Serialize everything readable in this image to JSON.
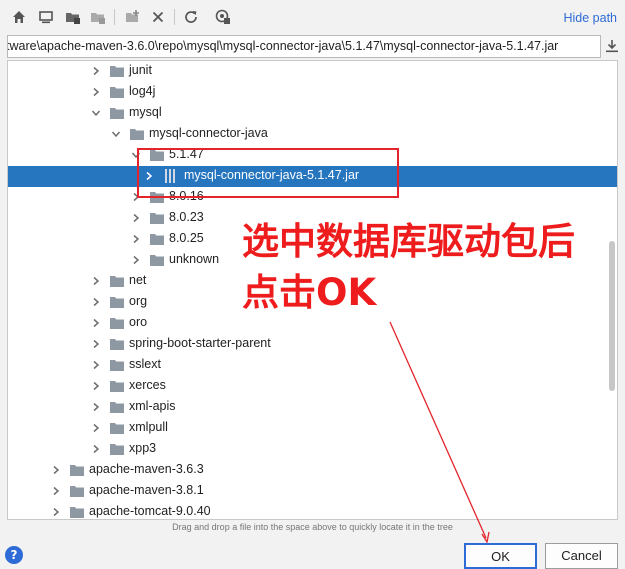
{
  "toolbar": {
    "buttons": [
      "home-icon",
      "desktop-icon",
      "project-icon",
      "module-icon",
      "new-folder-icon",
      "delete-icon",
      "refresh-icon",
      "show-hidden-icon"
    ],
    "hide_path_label": "Hide path"
  },
  "path_field": {
    "value": "tware\\apache-maven-3.6.0\\repo\\mysql\\mysql-connector-java\\5.1.47\\mysql-connector-java-5.1.47.jar"
  },
  "tree": {
    "rows": [
      {
        "label": "junit",
        "depth": 4,
        "expanded": false,
        "type": "folder"
      },
      {
        "label": "log4j",
        "depth": 4,
        "expanded": false,
        "type": "folder"
      },
      {
        "label": "mysql",
        "depth": 4,
        "expanded": true,
        "type": "folder"
      },
      {
        "label": "mysql-connector-java",
        "depth": 5,
        "expanded": true,
        "type": "folder"
      },
      {
        "label": "5.1.47",
        "depth": 6,
        "expanded": true,
        "type": "folder"
      },
      {
        "label": "mysql-connector-java-5.1.47.jar",
        "depth": 7,
        "expanded": false,
        "type": "jar",
        "selected": true
      },
      {
        "label": "8.0.16",
        "depth": 6,
        "expanded": false,
        "type": "folder"
      },
      {
        "label": "8.0.23",
        "depth": 6,
        "expanded": false,
        "type": "folder"
      },
      {
        "label": "8.0.25",
        "depth": 6,
        "expanded": false,
        "type": "folder"
      },
      {
        "label": "unknown",
        "depth": 6,
        "expanded": false,
        "type": "folder"
      },
      {
        "label": "net",
        "depth": 4,
        "expanded": false,
        "type": "folder"
      },
      {
        "label": "org",
        "depth": 4,
        "expanded": false,
        "type": "folder"
      },
      {
        "label": "oro",
        "depth": 4,
        "expanded": false,
        "type": "folder"
      },
      {
        "label": "spring-boot-starter-parent",
        "depth": 4,
        "expanded": false,
        "type": "folder"
      },
      {
        "label": "sslext",
        "depth": 4,
        "expanded": false,
        "type": "folder"
      },
      {
        "label": "xerces",
        "depth": 4,
        "expanded": false,
        "type": "folder"
      },
      {
        "label": "xml-apis",
        "depth": 4,
        "expanded": false,
        "type": "folder"
      },
      {
        "label": "xmlpull",
        "depth": 4,
        "expanded": false,
        "type": "folder"
      },
      {
        "label": "xpp3",
        "depth": 4,
        "expanded": false,
        "type": "folder"
      },
      {
        "label": "apache-maven-3.6.3",
        "depth": 2,
        "expanded": false,
        "type": "folder"
      },
      {
        "label": "apache-maven-3.8.1",
        "depth": 2,
        "expanded": false,
        "type": "folder"
      },
      {
        "label": "apache-tomcat-9.0.40",
        "depth": 2,
        "expanded": false,
        "type": "folder"
      }
    ]
  },
  "annotation": {
    "line1": "选中数据库驱动包后",
    "line2": "点击OK",
    "color": "#ee1c1c"
  },
  "hint": "Drag and drop a file into the space above to quickly locate it in the tree",
  "footer": {
    "help_label": "?",
    "ok_label": "OK",
    "cancel_label": "Cancel"
  },
  "colors": {
    "selection": "#2675bf",
    "link": "#2f6bd6",
    "folder": "#8e98a3"
  }
}
